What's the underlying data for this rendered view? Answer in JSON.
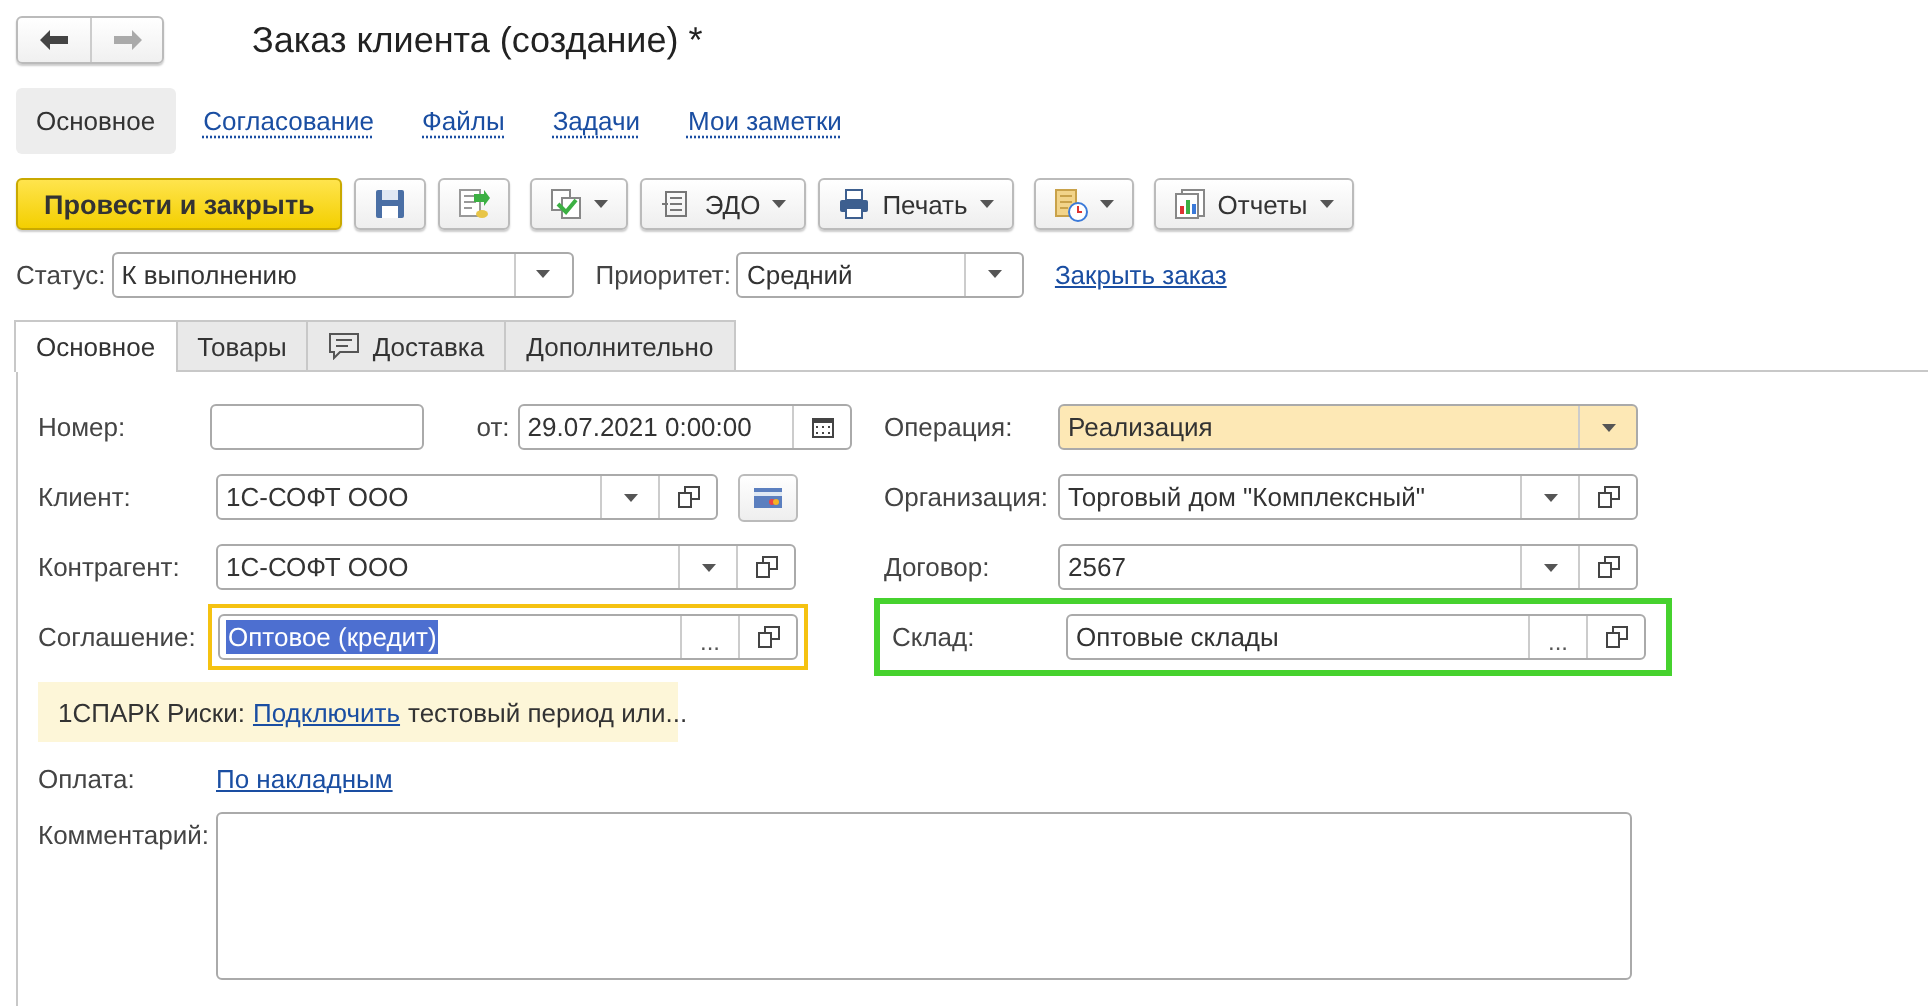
{
  "window": {
    "title": "Заказ клиента (создание) *",
    "nav": [
      {
        "kind": "back",
        "disabled": false
      },
      {
        "kind": "forward",
        "disabled": true
      }
    ]
  },
  "sections": [
    {
      "label": "Основное",
      "selected": true
    },
    {
      "label": "Согласование",
      "selected": false
    },
    {
      "label": "Файлы",
      "selected": false
    },
    {
      "label": "Задачи",
      "selected": false
    },
    {
      "label": "Мои заметки",
      "selected": false
    }
  ],
  "toolbar": [
    {
      "kind": "primary",
      "label": "Провести и закрыть",
      "menu": false
    },
    {
      "kind": "save",
      "menu": false
    },
    {
      "kind": "post",
      "menu": false
    },
    {
      "kind": "related",
      "menu": true
    },
    {
      "kind": "edo",
      "label": "ЭДО",
      "menu": true
    },
    {
      "kind": "print",
      "label": "Печать",
      "menu": true
    },
    {
      "kind": "attach",
      "menu": true
    },
    {
      "kind": "reports",
      "label": "Отчеты",
      "menu": true
    }
  ],
  "status": {
    "label": "Статус:",
    "value": "К выполнению",
    "buttons": [
      {
        "kind": "dropdown"
      }
    ]
  },
  "priority": {
    "label": "Приоритет:",
    "value": "Средний",
    "buttons": [
      {
        "kind": "dropdown"
      }
    ]
  },
  "close_link": "Закрыть заказ",
  "tabs": [
    {
      "label": "Основное",
      "kind": "plain",
      "selected": true
    },
    {
      "label": "Товары",
      "kind": "plain",
      "selected": false
    },
    {
      "label": "Доставка",
      "kind": "comment",
      "selected": false
    },
    {
      "label": "Дополнительно",
      "kind": "plain",
      "selected": false
    }
  ],
  "form": {
    "number": {
      "label": "Номер:"
    },
    "date": {
      "label": "от:",
      "value": "29.07.2021  0:00:00",
      "buttons": [
        {
          "kind": "calendar"
        }
      ]
    },
    "client": {
      "label": "Клиент:",
      "value": "1С-СОФТ ООО",
      "buttons": [
        {
          "kind": "dropdown"
        },
        {
          "kind": "open"
        }
      ]
    },
    "contractor": {
      "label": "Контрагент:",
      "value": "1С-СОФТ ООО",
      "buttons": [
        {
          "kind": "dropdown"
        },
        {
          "kind": "open"
        }
      ]
    },
    "agreement": {
      "label": "Соглашение:",
      "value": "Оптовое (кредит)",
      "text_selected": true,
      "color": "#f5c211",
      "buttons": [
        {
          "kind": "select",
          "label": "..."
        },
        {
          "kind": "open"
        }
      ]
    },
    "operation": {
      "label": "Операция:",
      "value": "Реализация",
      "accent": true,
      "buttons": [
        {
          "kind": "dropdown"
        }
      ]
    },
    "organization": {
      "label": "Организация:",
      "value": "Торговый дом \"Комплексный\"",
      "buttons": [
        {
          "kind": "dropdown"
        },
        {
          "kind": "open"
        }
      ]
    },
    "contract": {
      "label": "Договор:",
      "value": "2567",
      "buttons": [
        {
          "kind": "dropdown"
        },
        {
          "kind": "open"
        }
      ]
    },
    "warehouse": {
      "label": "Склад:",
      "value": "Оптовые склады",
      "color": "#46d22e",
      "buttons": [
        {
          "kind": "select",
          "label": "..."
        },
        {
          "kind": "open"
        }
      ]
    },
    "spark": {
      "prefix": "1СПАРК Риски:",
      "link": "Подключить",
      "suffix": "тестовый период или..."
    },
    "payment": {
      "label": "Оплата:",
      "link": "По накладным"
    },
    "comment": {
      "label": "Комментарий:"
    }
  }
}
